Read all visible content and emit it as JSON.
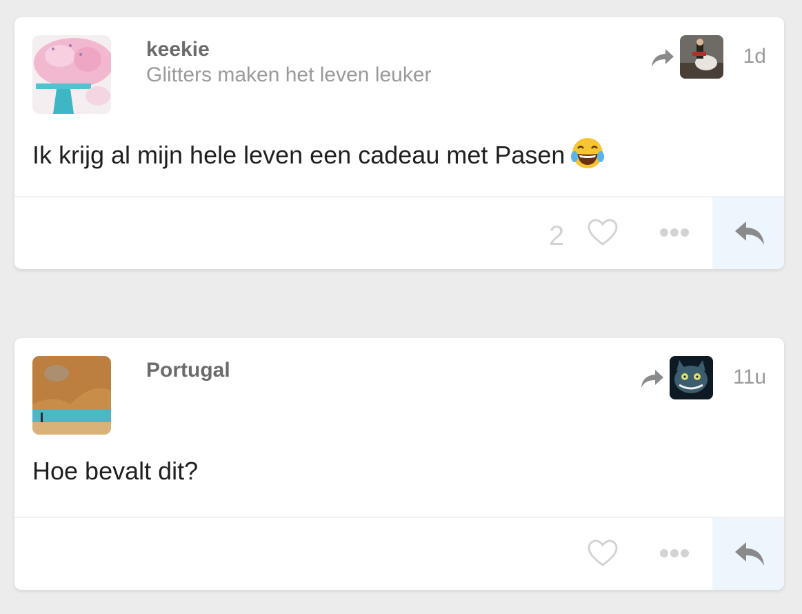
{
  "posts": [
    {
      "username": "keekie",
      "subtitle": "Glitters maken het leven leuker",
      "time": "1d",
      "text": "Ik krijg al mijn hele leven een cadeau met Pasen",
      "emoji": "laughing-tears-emoji",
      "like_count": "2",
      "avatar": "cake-photo",
      "reposter_avatar": "horse-rider-painting"
    },
    {
      "username": "Portugal",
      "subtitle": "",
      "time": "11u",
      "text": "Hoe bevalt dit?",
      "emoji": "",
      "like_count": "",
      "avatar": "sea-cave-photo",
      "reposter_avatar": "cheshire-cat-image"
    }
  ],
  "icons": {
    "share": "share-arrow-icon",
    "like": "heart-icon",
    "more": "more-dots-icon",
    "reply": "reply-arrow-icon"
  },
  "colors": {
    "background": "#ececec",
    "card": "#ffffff",
    "reply_background": "#eef6fd",
    "icon_gray": "#8a8a8a",
    "muted": "#d3d3d3"
  }
}
